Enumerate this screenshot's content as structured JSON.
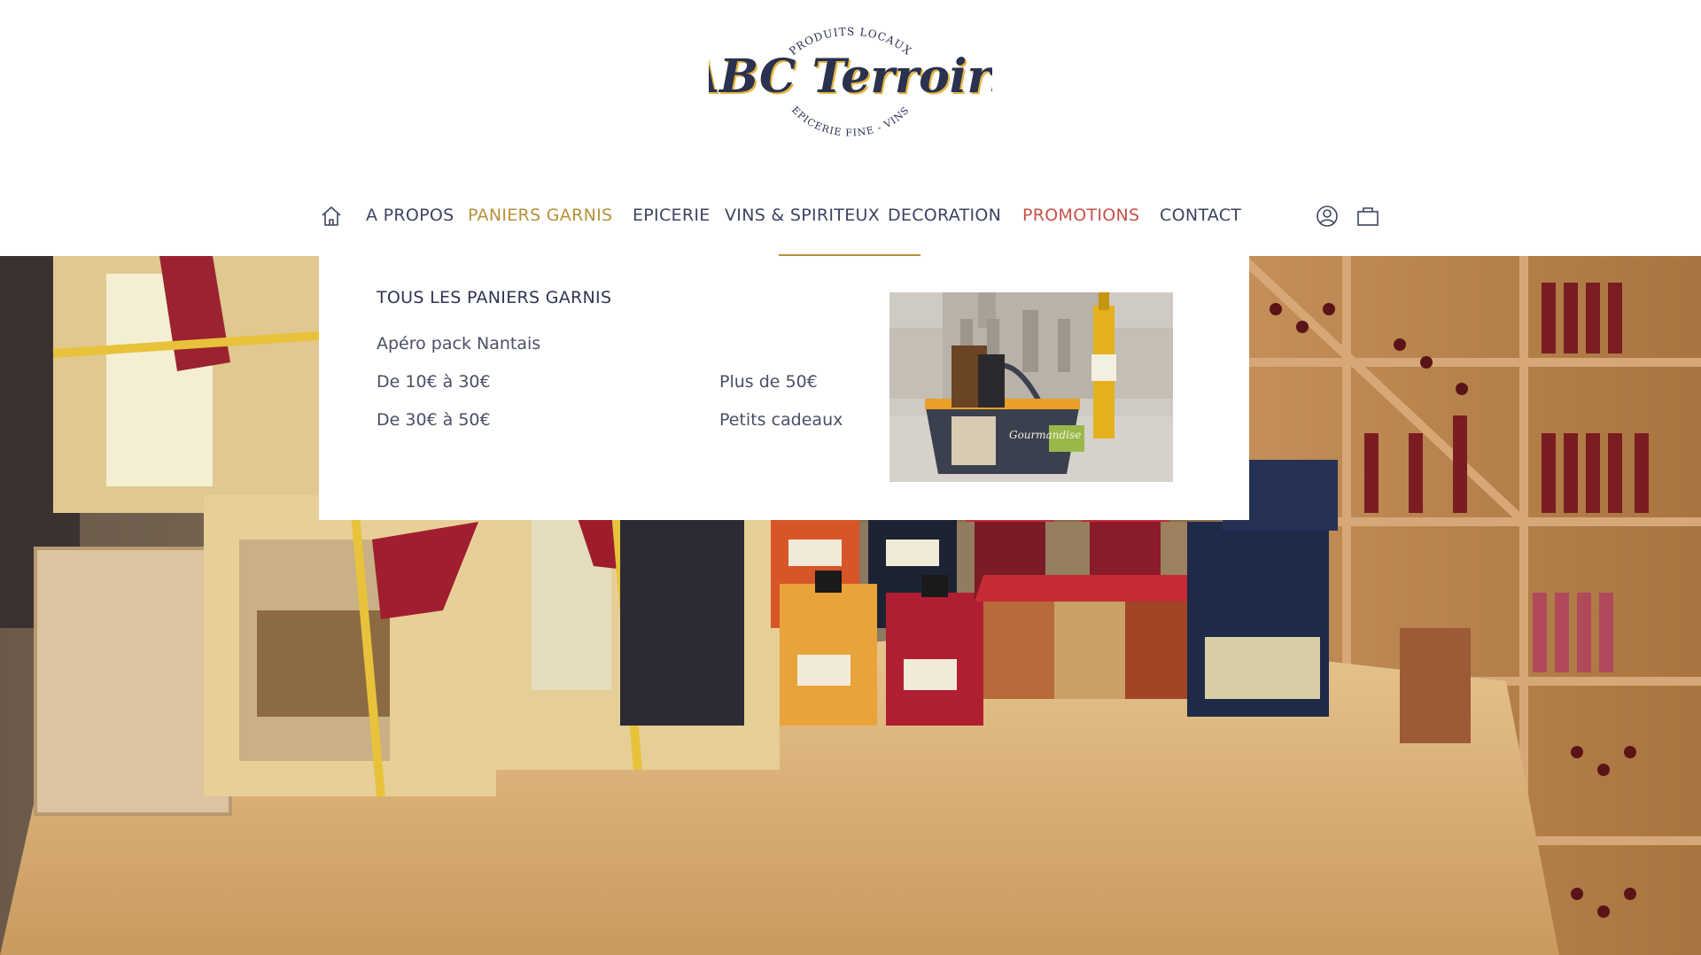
{
  "brand": {
    "name": "ABC Terroirs",
    "arc_top": "PRODUITS LOCAUX",
    "arc_bottom": "EPICERIE FINE - VINS"
  },
  "nav": {
    "items": [
      {
        "label": "A PROPOS"
      },
      {
        "label": "PANIERS GARNIS"
      },
      {
        "label": "EPICERIE"
      },
      {
        "label": "VINS & SPIRITEUX"
      },
      {
        "label": "DECORATION"
      },
      {
        "label": "PROMOTIONS"
      },
      {
        "label": "CONTACT"
      }
    ],
    "active_index": 1,
    "icons": {
      "home": "home-icon",
      "account": "user-icon",
      "cart": "shopping-bag-icon"
    }
  },
  "mega_menu": {
    "title": "TOUS LES PANIERS GARNIS",
    "links": [
      {
        "label": "Apéro pack Nantais"
      },
      {
        "label": "De 10€ à 30€"
      },
      {
        "label": "De 30€ à 50€"
      },
      {
        "label": "Plus de 50€"
      },
      {
        "label": "Petits cadeaux"
      }
    ],
    "image_text": "Gourmandise"
  },
  "colors": {
    "accent_gold": "#b4923a",
    "promo_red": "#c8504a",
    "nav_text": "#3d4460",
    "logo_navy": "#2b3150"
  }
}
